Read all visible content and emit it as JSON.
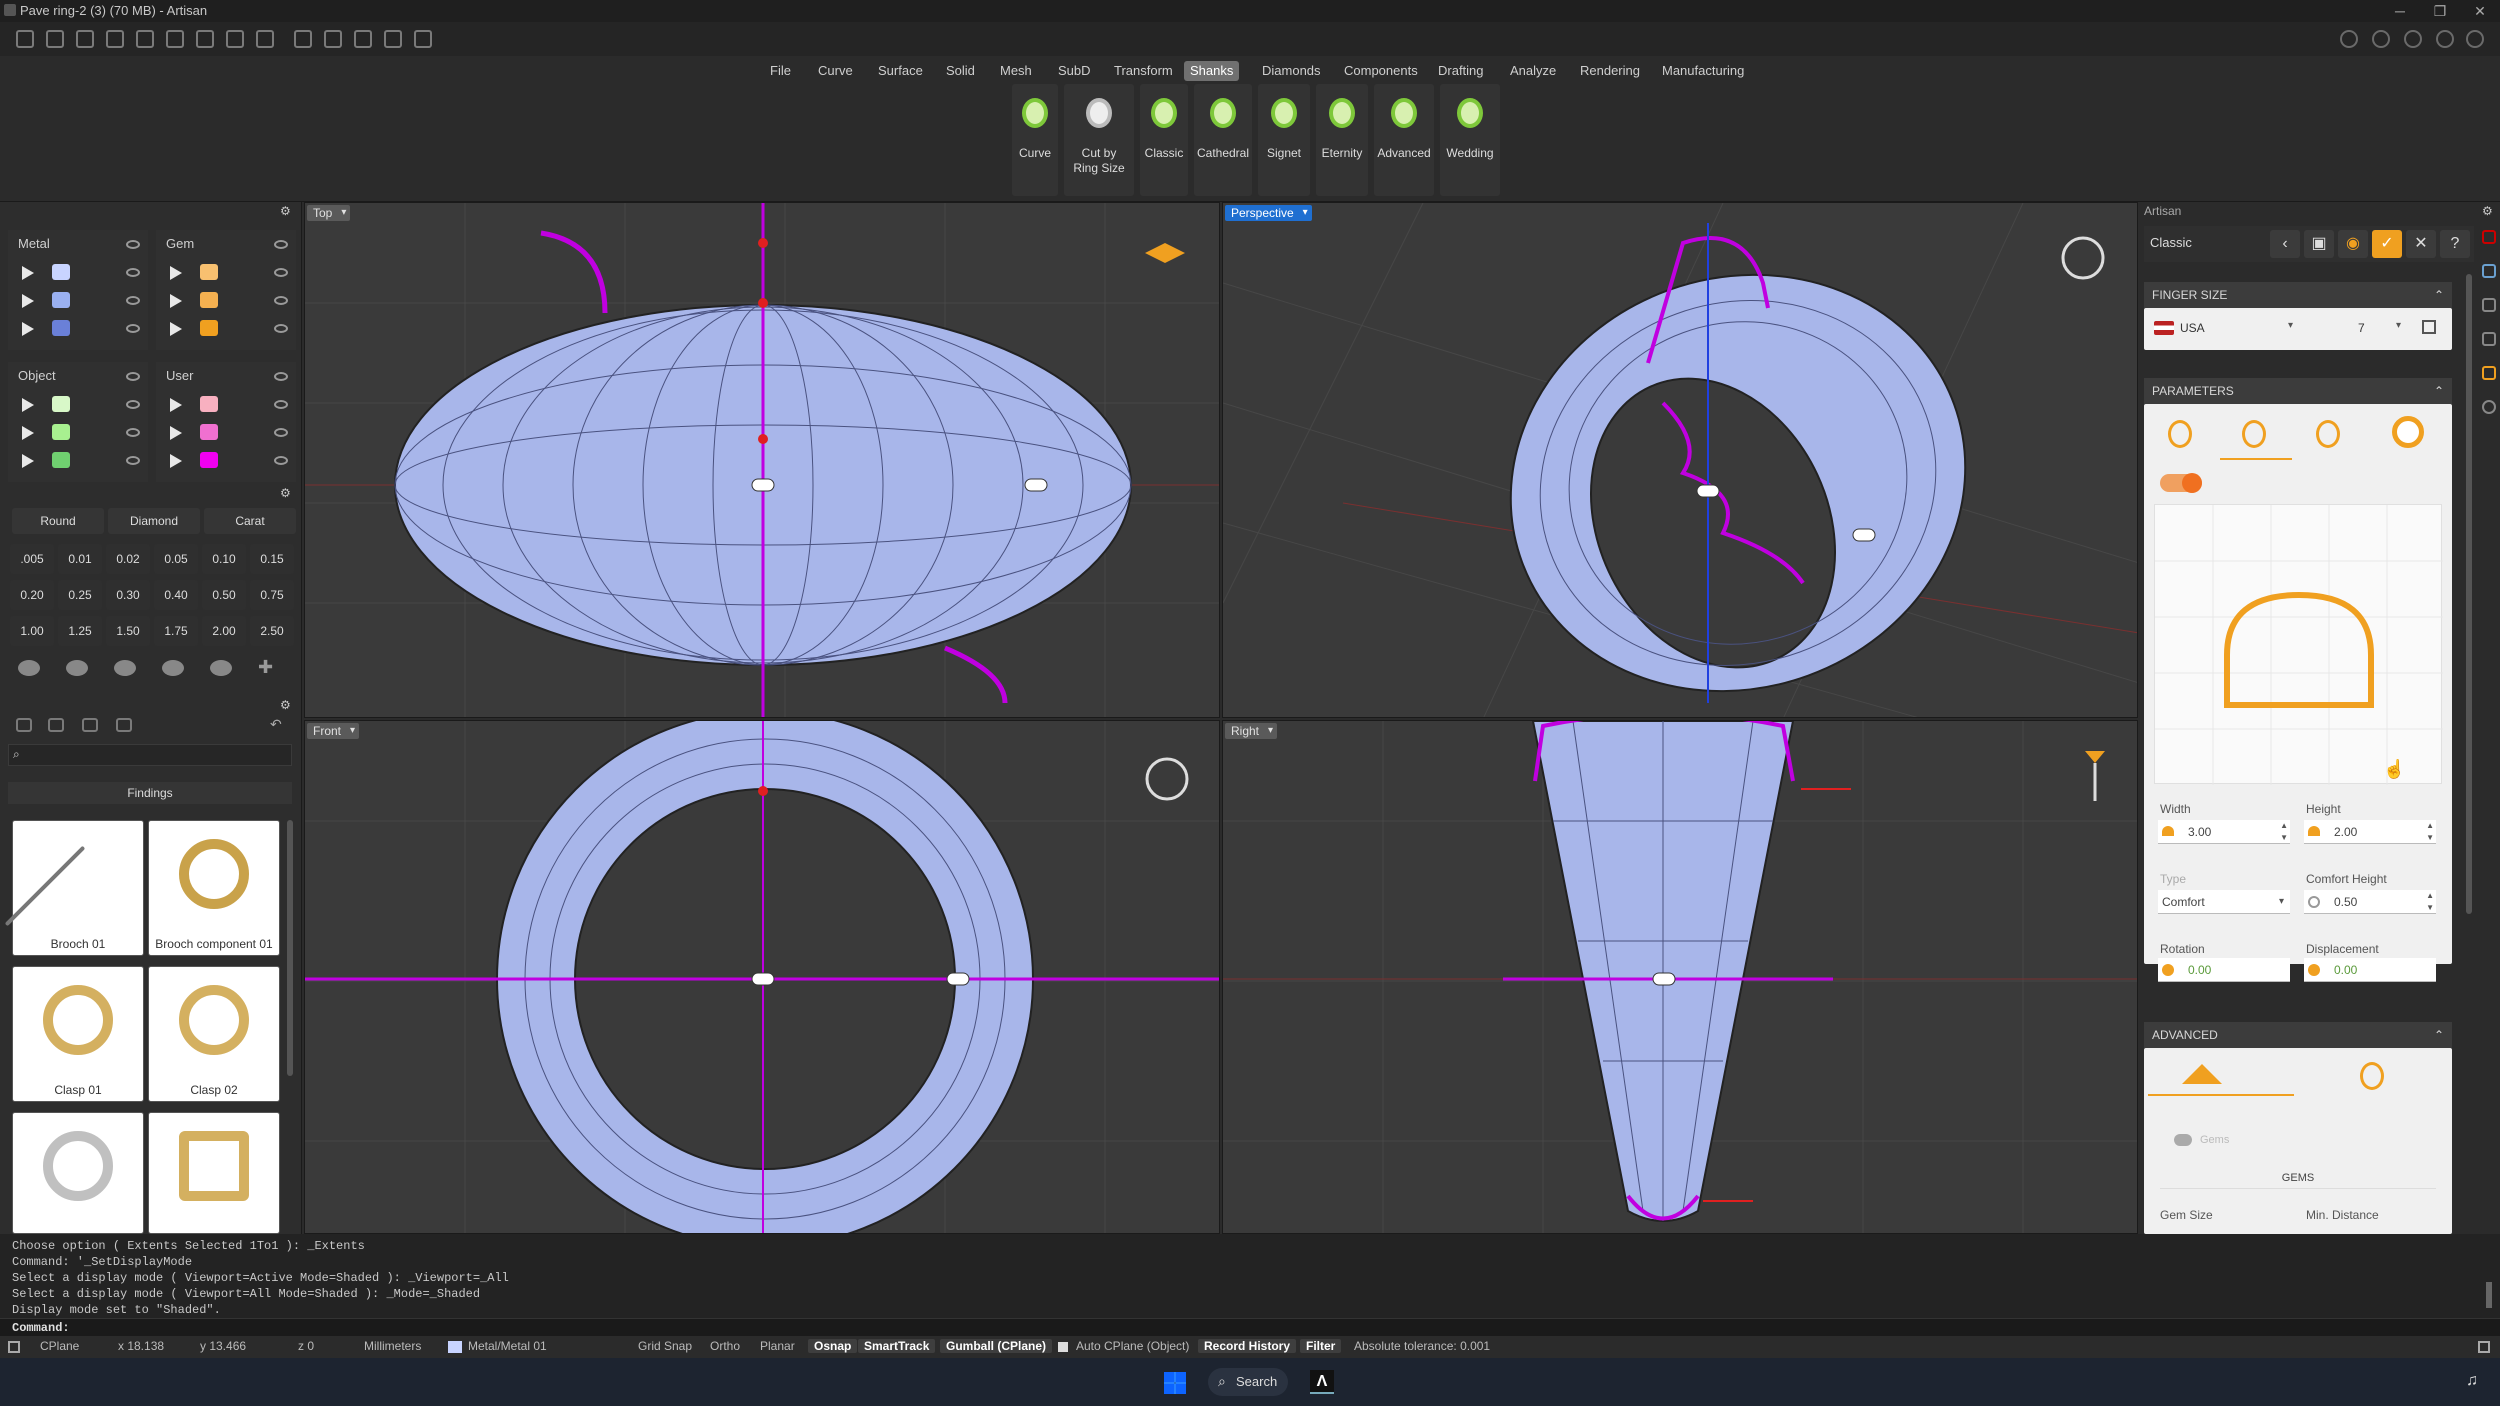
{
  "window": {
    "title": "Pave ring-2 (3) (70 MB) - Artisan"
  },
  "menu": {
    "items": [
      "File",
      "Curve",
      "Surface",
      "Solid",
      "Mesh",
      "SubD",
      "Transform",
      "Shanks",
      "Diamonds",
      "Components",
      "Drafting",
      "Analyze",
      "Rendering",
      "Manufacturing"
    ],
    "active": "Shanks"
  },
  "ribbon": {
    "buttons": [
      "Curve",
      "Cut by Ring Size",
      "Classic",
      "Cathedral",
      "Signet",
      "Eternity",
      "Advanced",
      "Wedding"
    ]
  },
  "layers": {
    "metal": {
      "label": "Metal",
      "colors": [
        "#c8d4ff",
        "#9ab0f0",
        "#6a80d8"
      ]
    },
    "gem": {
      "label": "Gem",
      "colors": [
        "#f8c070",
        "#f4b050",
        "#f0a020"
      ]
    },
    "object": {
      "label": "Object",
      "colors": [
        "#d8f8c8",
        "#a8f090",
        "#70d070"
      ]
    },
    "user": {
      "label": "User",
      "colors": [
        "#f8b0c0",
        "#f070d0",
        "#f000f0"
      ]
    }
  },
  "gem_tools": {
    "shape_label": "Round",
    "type_label": "Diamond",
    "unit_label": "Carat",
    "carats": [
      ".005",
      "0.01",
      "0.02",
      "0.05",
      "0.10",
      "0.15",
      "0.20",
      "0.25",
      "0.30",
      "0.40",
      "0.50",
      "0.75",
      "1.00",
      "1.25",
      "1.50",
      "1.75",
      "2.00",
      "2.50"
    ]
  },
  "library": {
    "search_placeholder": "",
    "category": "Findings",
    "items": [
      "Brooch 01",
      "Brooch component 01",
      "Clasp 01",
      "Clasp 02"
    ]
  },
  "viewports": {
    "top": "Top",
    "perspective": "Perspective",
    "front": "Front",
    "right": "Right"
  },
  "artisan_panel": {
    "title": "Artisan",
    "preset": "Classic",
    "finger_size": {
      "header": "FINGER SIZE",
      "region": "USA",
      "size": "7"
    },
    "parameters": {
      "header": "PARAMETERS",
      "width_label": "Width",
      "width": "3.00",
      "height_label": "Height",
      "height": "2.00",
      "type_label": "Type",
      "type": "Comfort",
      "comfort_height_label": "Comfort Height",
      "comfort_height": "0.50",
      "rotation_label": "Rotation",
      "rotation": "0.00",
      "displacement_label": "Displacement",
      "displacement": "0.00"
    },
    "advanced": {
      "header": "ADVANCED",
      "gems_toggle_label": "Gems",
      "gems_section": "GEMS",
      "gem_size_label": "Gem Size",
      "min_distance_label": "Min. Distance"
    }
  },
  "command": {
    "lines": [
      "Choose option ( Extents  Selected  1To1 ): _Extents",
      "Command: '_SetDisplayMode",
      "Select a display mode ( Viewport=Active  Mode=Shaded ): _Viewport=_All",
      "Select a display mode ( Viewport=All  Mode=Shaded ): _Mode=_Shaded",
      "Display mode set to \"Shaded\"."
    ],
    "prompt": "Command:"
  },
  "status": {
    "cplane": "CPlane",
    "x": "x 18.138",
    "y": "y 13.466",
    "z": "z 0",
    "units": "Millimeters",
    "layer": "Metal/Metal 01",
    "grid_snap": "Grid Snap",
    "ortho": "Ortho",
    "planar": "Planar",
    "osnap": "Osnap",
    "smarttrack": "SmartTrack",
    "gumball": "Gumball (CPlane)",
    "auto_cplane": "Auto CPlane (Object)",
    "record_history": "Record History",
    "filter": "Filter",
    "tolerance": "Absolute tolerance: 0.001"
  },
  "taskbar": {
    "search": "Search"
  },
  "colors": {
    "ring": "#a8b6ea",
    "accent": "#f07020",
    "magenta": "#c000e0"
  }
}
